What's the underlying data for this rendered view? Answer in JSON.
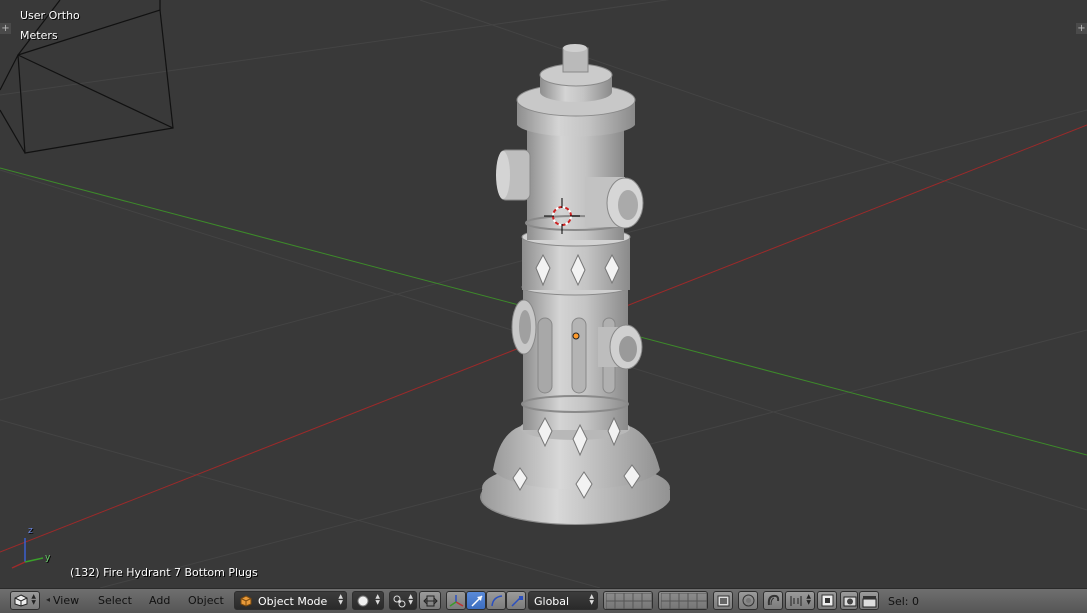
{
  "viewport": {
    "view_name": "User Ortho",
    "units": "Meters",
    "object_info": "(132) Fire Hydrant 7 Bottom Plugs",
    "axis_labels": {
      "z": "z",
      "y": "y"
    }
  },
  "header": {
    "menus": [
      "View",
      "Select",
      "Add",
      "Object"
    ],
    "mode": "Object Mode",
    "orientation": "Global",
    "selection": "Sel: 0"
  },
  "icons": {
    "editor_type": "3d-view-cube-icon",
    "viewport_shading": "solid-sphere-icon",
    "pivot": "pivot-point-icon",
    "manipulator": "manipulator-icon",
    "translate": "translate-arrow-icon",
    "rotate": "rotate-arc-icon",
    "scale": "scale-icon",
    "layers": "layer-grid-icon",
    "lock": "lock-camera-icon",
    "proportional": "proportional-edit-icon",
    "snap": "snap-magnet-icon",
    "render": "opengl-render-icon"
  },
  "colors": {
    "viewport_bg": "#393939",
    "x_axis": "#9c2a2a",
    "y_axis": "#3d8a2a",
    "header_bg": "#6a6a6a",
    "model": "#c6c6c6"
  }
}
